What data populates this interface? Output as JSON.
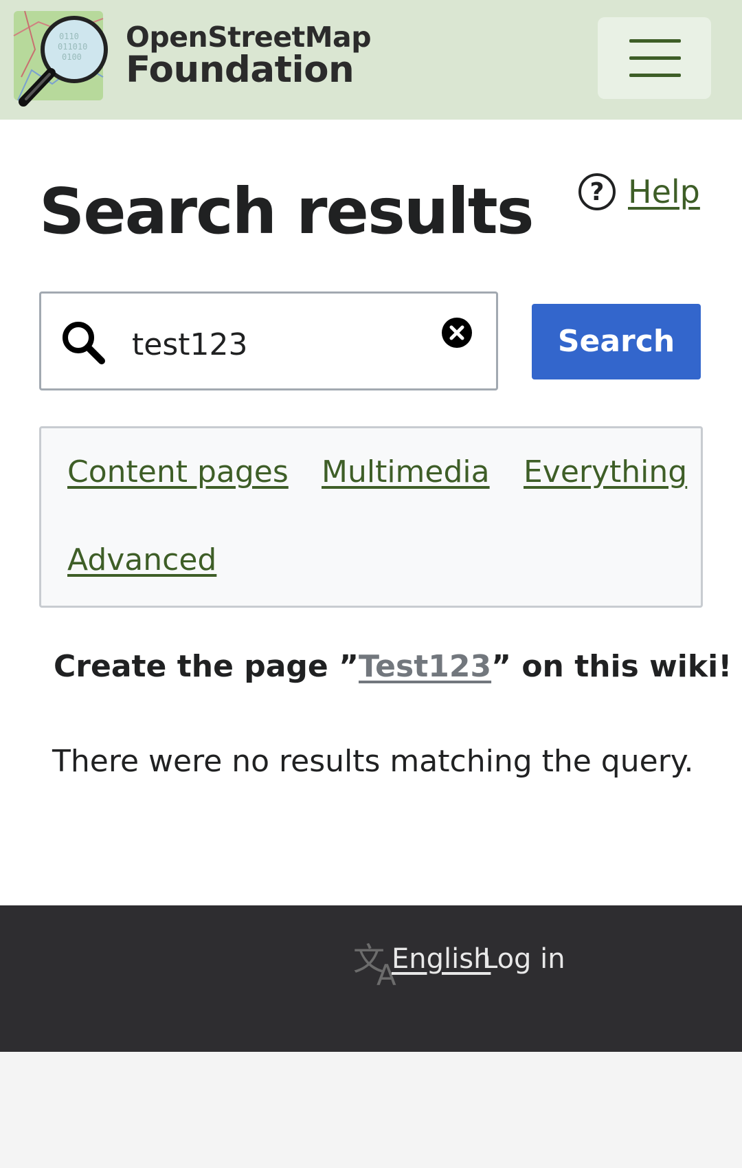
{
  "header": {
    "logo_line1": "OpenStreetMap",
    "logo_line2": "Foundation",
    "menu_icon": "hamburger-menu-icon"
  },
  "main": {
    "title": "Search results",
    "help_label": "Help",
    "search": {
      "value": "test123",
      "button_label": "Search"
    },
    "filters": [
      "Content pages",
      "Multimedia",
      "Everything",
      "Advanced"
    ],
    "create_prefix": "Create the page ”",
    "create_link": "Test123",
    "create_suffix": "” on this wiki!",
    "no_results": "There were no results matching the query."
  },
  "footer": {
    "language": "English",
    "login": "Log in"
  },
  "colors": {
    "header_bg": "#dae6d2",
    "link_green": "#3e5e27",
    "button_blue": "#3366cc",
    "footer_bg": "#2e2d30"
  }
}
